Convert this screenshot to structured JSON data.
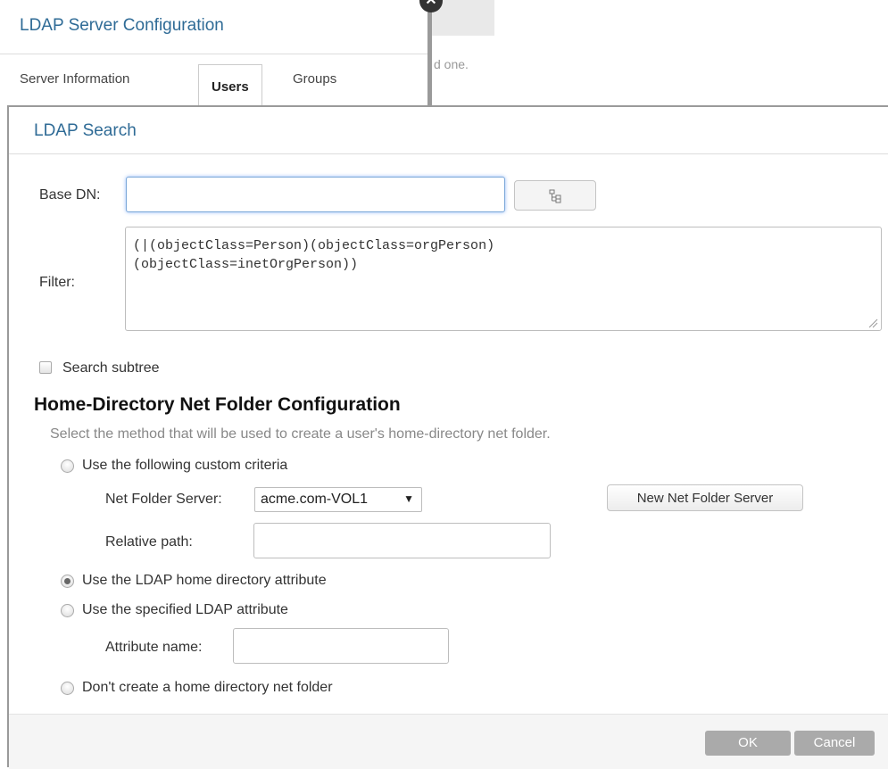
{
  "background_dialog": {
    "title": "LDAP Server Configuration",
    "close_icon": "close-icon",
    "tabs": [
      {
        "label": "Server Information",
        "active": false
      },
      {
        "label": "Users",
        "active": true
      },
      {
        "label": "Groups",
        "active": false
      }
    ],
    "hint_fragment": "d one."
  },
  "dialog": {
    "title": "LDAP Search",
    "base_dn": {
      "label": "Base DN:",
      "value": "",
      "browse_icon": "tree-icon"
    },
    "filter": {
      "label": "Filter:",
      "value": "(|(objectClass=Person)(objectClass=orgPerson)\n(objectClass=inetOrgPerson))"
    },
    "search_subtree": {
      "label": "Search subtree",
      "checked": false
    },
    "home_directory": {
      "heading": "Home-Directory Net Folder Configuration",
      "description": "Select the method that will be used to create a user's home-directory net folder.",
      "options": {
        "custom": {
          "label": "Use the following custom criteria",
          "selected": false
        },
        "ldap_home": {
          "label": "Use the LDAP home directory attribute",
          "selected": true
        },
        "specified": {
          "label": "Use the specified LDAP attribute",
          "selected": false
        },
        "none": {
          "label": "Don't create a home directory net folder",
          "selected": false
        }
      },
      "net_folder_server": {
        "label": "Net Folder Server:",
        "selected": "acme.com-VOL1",
        "caret": "▼"
      },
      "new_server_button": "New Net Folder Server",
      "relative_path": {
        "label": "Relative path:",
        "value": ""
      },
      "attribute_name": {
        "label": "Attribute name:",
        "value": ""
      }
    },
    "footer": {
      "ok": "OK",
      "cancel": "Cancel"
    }
  },
  "colors": {
    "title_blue": "#2f6b96",
    "focus_ring": "#7aa7d8",
    "footer_button": "#aaaaaa"
  }
}
